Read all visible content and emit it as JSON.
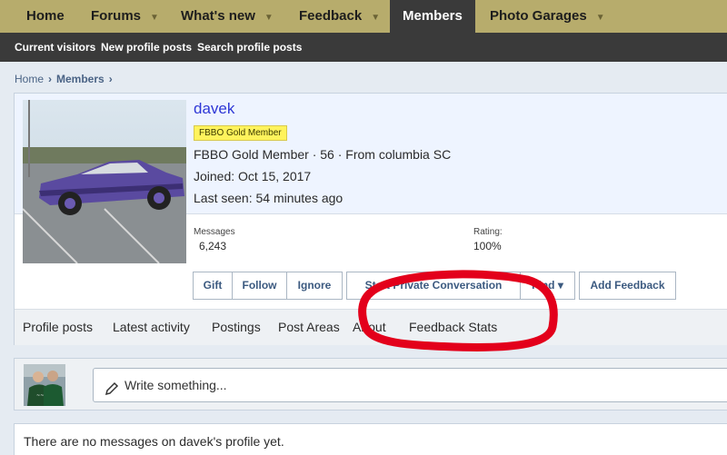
{
  "top_nav": {
    "items": [
      {
        "label": "Home",
        "has_dropdown": false,
        "active": false
      },
      {
        "label": "Forums",
        "has_dropdown": true,
        "active": false
      },
      {
        "label": "What's new",
        "has_dropdown": true,
        "active": false
      },
      {
        "label": "Feedback",
        "has_dropdown": true,
        "active": false
      },
      {
        "label": "Members",
        "has_dropdown": false,
        "active": true
      },
      {
        "label": "Photo Garages",
        "has_dropdown": true,
        "active": false
      }
    ],
    "caret": "▼"
  },
  "sub_nav": {
    "items": [
      "Current visitors",
      "New profile posts",
      "Search profile posts"
    ]
  },
  "breadcrumb": {
    "items": [
      "Home",
      "Members"
    ],
    "sep": "›"
  },
  "profile": {
    "username": "davek",
    "badge": "FBBO Gold Member",
    "line1": "FBBO Gold Member · 56 · From columbia SC",
    "joined": "Joined: Oct 15, 2017",
    "last_seen": "Last seen: 54 minutes ago",
    "stats": {
      "messages_label": "Messages",
      "messages_value": "6,243",
      "rating_label": "Rating:",
      "rating_value": "100%"
    },
    "buttons": {
      "gift": "Gift",
      "follow": "Follow",
      "ignore": "Ignore",
      "start_conversation": "Start Private Conversation",
      "find": "Find ▾",
      "add_feedback": "Add Feedback"
    },
    "tabs": [
      "Profile posts",
      "Latest activity",
      "Postings",
      "Post Areas",
      "About",
      "Feedback Stats"
    ]
  },
  "compose": {
    "placeholder": "Write something..."
  },
  "empty_message": "There are no messages on davek's profile yet.",
  "colors": {
    "nav_bg": "#b7ac6c",
    "nav_active_bg": "#3a3a3a",
    "accent_link": "#2e37d6",
    "badge_bg": "#fff35c",
    "annotation_red": "#e3001b"
  }
}
